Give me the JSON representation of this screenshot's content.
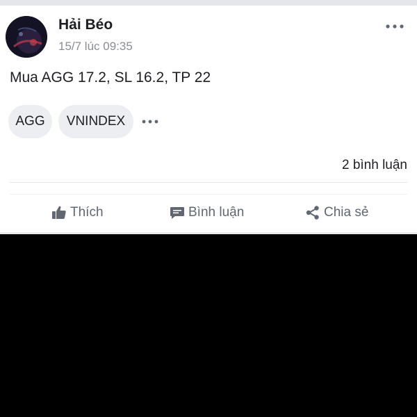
{
  "post": {
    "author": "Hải Béo",
    "timestamp": "15/7 lúc 09:35",
    "content": "Mua AGG 17.2, SL 16.2, TP 22",
    "tags": [
      "AGG",
      "VNINDEX"
    ],
    "comments_count": "2 bình luận"
  },
  "actions": {
    "like": "Thích",
    "comment": "Bình luận",
    "share": "Chia sẻ"
  },
  "icons": {
    "more_top": "more-horizontal-icon",
    "more_tags": "more-horizontal-icon",
    "like": "thumbs-up-icon",
    "comment": "comment-bubble-icon",
    "share": "share-icon"
  },
  "colors": {
    "text_primary": "#1c1e21",
    "text_secondary": "#8a8d91",
    "action_text": "#606770",
    "chip_background": "#eceef1",
    "card_background": "#ffffff",
    "page_background": "#000000"
  }
}
